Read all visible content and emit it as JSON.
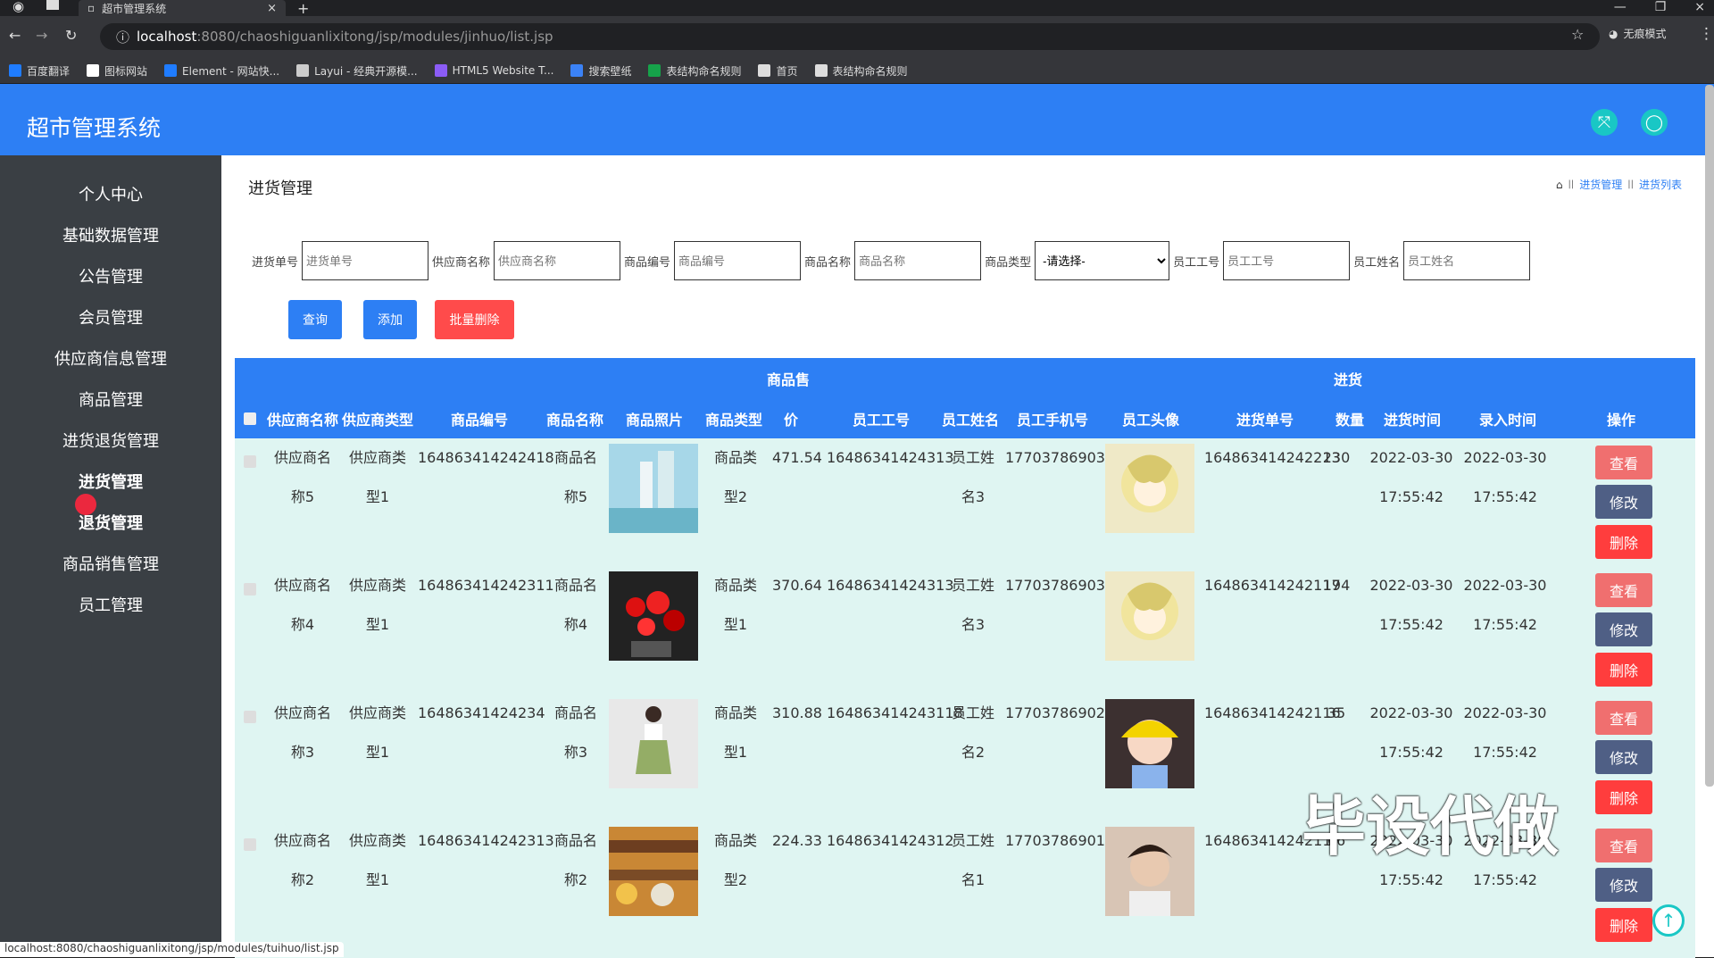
{
  "browser": {
    "tab_title": "超市管理系统",
    "url_host": "localhost",
    "url_path": ":8080/chaoshiguanlixitong/jsp/modules/jinhuo/list.jsp",
    "profile": "无痕模式",
    "bookmarks": [
      "百度翻译",
      "图标网站",
      "Element - 网站快...",
      "Layui - 经典开源模...",
      "HTML5 Website T...",
      "搜索壁纸",
      "表结构命名规则",
      "首页",
      "表结构命名规则"
    ]
  },
  "app": {
    "title": "超市管理系统"
  },
  "sidebar": {
    "items": [
      "个人中心",
      "基础数据管理",
      "公告管理",
      "会员管理",
      "供应商信息管理",
      "商品管理",
      "进货退货管理",
      "进货管理",
      "退货管理",
      "商品销售管理",
      "员工管理"
    ]
  },
  "page": {
    "title": "进货管理",
    "breadcrumb": [
      "进货管理",
      "进货列表"
    ]
  },
  "search": {
    "labels": [
      "进货单号",
      "供应商名称",
      "商品编号",
      "商品名称",
      "商品类型",
      "员工工号",
      "员工姓名"
    ],
    "placeholders": [
      "进货单号",
      "供应商名称",
      "商品编号",
      "商品名称",
      "员工工号",
      "员工姓名"
    ],
    "select_value": "-请选择-"
  },
  "buttons": {
    "query": "查询",
    "add": "添加",
    "batch_delete": "批量删除",
    "view": "查看",
    "edit": "修改",
    "delete": "删除"
  },
  "table": {
    "groups": [
      "商品售",
      "进货"
    ],
    "headers": [
      "供应商名称",
      "供应商类型",
      "商品编号",
      "商品名称",
      "商品照片",
      "商品类型",
      "价",
      "员工工号",
      "员工姓名",
      "员工手机号",
      "员工头像",
      "进货单号",
      "数量",
      "进货时间",
      "录入时间",
      "操作"
    ],
    "rows": [
      {
        "supplier": [
          "供应商名",
          "称5"
        ],
        "type": [
          "供应商类",
          "型1"
        ],
        "code": "164863414242418",
        "name": [
          "商品名",
          "称5"
        ],
        "ptype": [
          "商品类",
          "型2"
        ],
        "price": "471.54",
        "eid": "16486341424313",
        "ename": [
          "员工姓",
          "名3"
        ],
        "phone": "17703786903",
        "order": "164863414242213",
        "qty": "230",
        "time": [
          "2022-03-30",
          "17:55:42"
        ],
        "entry": [
          "2022-03-30",
          "17:55:42"
        ],
        "img": "bottles",
        "avatar": "yellow"
      },
      {
        "supplier": [
          "供应商名",
          "称4"
        ],
        "type": [
          "供应商类",
          "型1"
        ],
        "code": "164863414242311",
        "name": [
          "商品名",
          "称4"
        ],
        "ptype": [
          "商品类",
          "型1"
        ],
        "price": "370.64",
        "eid": "16486341424313",
        "ename": [
          "员工姓",
          "名3"
        ],
        "phone": "17703786903",
        "order": "164863414242117",
        "qty": "194",
        "time": [
          "2022-03-30",
          "17:55:42"
        ],
        "entry": [
          "2022-03-30",
          "17:55:42"
        ],
        "img": "flowers",
        "avatar": "yellow"
      },
      {
        "supplier": [
          "供应商名",
          "称3"
        ],
        "type": [
          "供应商类",
          "型1"
        ],
        "code": "16486341424234",
        "name": [
          "商品名",
          "称3"
        ],
        "ptype": [
          "商品类",
          "型1"
        ],
        "price": "310.88",
        "eid": "164863414243118",
        "ename": [
          "员工姓",
          "名2"
        ],
        "phone": "17703786902",
        "order": "164863414242116",
        "qty": "35",
        "time": [
          "2022-03-30",
          "17:55:42"
        ],
        "entry": [
          "2022-03-30",
          "17:55:42"
        ],
        "img": "dress",
        "avatar": "boy"
      },
      {
        "supplier": [
          "供应商名",
          "称2"
        ],
        "type": [
          "供应商类",
          "型1"
        ],
        "code": "164863414242313",
        "name": [
          "商品名",
          "称2"
        ],
        "ptype": [
          "商品类",
          "型2"
        ],
        "price": "224.33",
        "eid": "16486341424312",
        "ename": [
          "员工姓",
          "名1"
        ],
        "phone": "17703786901",
        "order": "16486341424211",
        "qty": "66",
        "time": [
          "2022-03-30",
          "17:55:42"
        ],
        "entry": [
          "2022-03-30",
          "17:55:42"
        ],
        "img": "shop",
        "avatar": "man"
      }
    ]
  },
  "watermark": "毕设代做",
  "status_url": "localhost:8080/chaoshiguanlixitong/jsp/modules/tuihuo/list.jsp"
}
